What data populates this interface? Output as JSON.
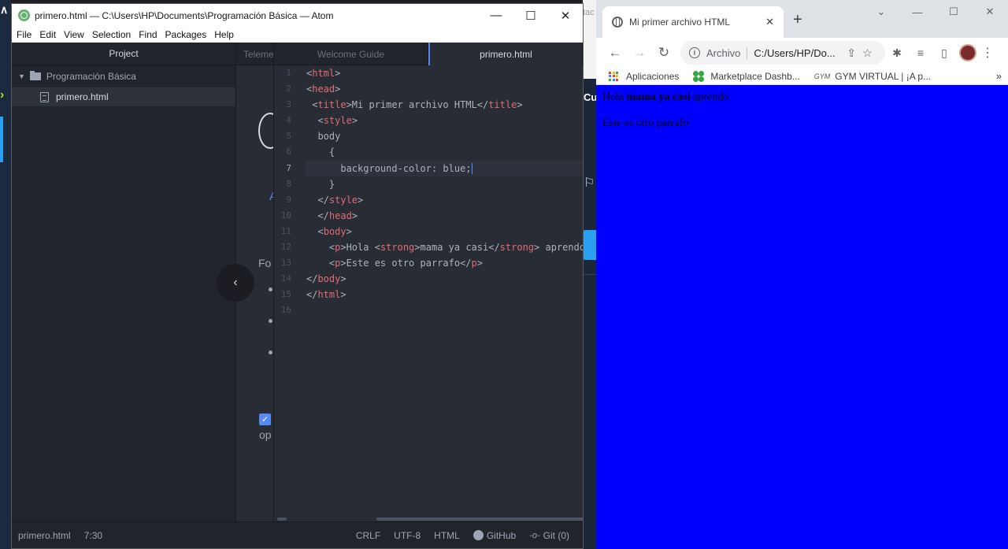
{
  "desktop": {
    "bg_mid_text": "tac",
    "bg_mid_label": "Cu"
  },
  "atom": {
    "window_title": "primero.html — C:\\Users\\HP\\Documents\\Programación Básica — Atom",
    "menu": [
      "File",
      "Edit",
      "View",
      "Selection",
      "Find",
      "Packages",
      "Help"
    ],
    "tree": {
      "header": "Project",
      "folder": "Programación Básica",
      "file": "primero.html"
    },
    "tabs": [
      "Telemet",
      "Welcome Guide",
      "primero.html"
    ],
    "guide_partial": {
      "fo": "Fo",
      "op": "op"
    },
    "code_lines": [
      "1",
      "2",
      "3",
      "4",
      "5",
      "6",
      "7",
      "8",
      "9",
      "10",
      "11",
      "12",
      "13",
      "14",
      "15",
      "16"
    ],
    "status": {
      "file": "primero.html",
      "cursor": "7:30",
      "line_ending": "CRLF",
      "encoding": "UTF-8",
      "grammar": "HTML",
      "github": "GitHub",
      "git": "Git (0)"
    }
  },
  "chrome": {
    "tab_title": "Mi primer archivo HTML",
    "omnibox_chip": "Archivo",
    "omnibox_url": "C:/Users/HP/Do...",
    "bookmarks": [
      "Aplicaciones",
      "Marketplace Dashb...",
      "GYM VIRTUAL | ¡A p..."
    ],
    "gym_logo": "GYM",
    "page": {
      "p1_before": "Hola ",
      "p1_strong": "mama ya casi",
      "p1_after": " aprendo",
      "p2": "Este es otro parrafo"
    },
    "page_bg_color": "#0000ff"
  }
}
